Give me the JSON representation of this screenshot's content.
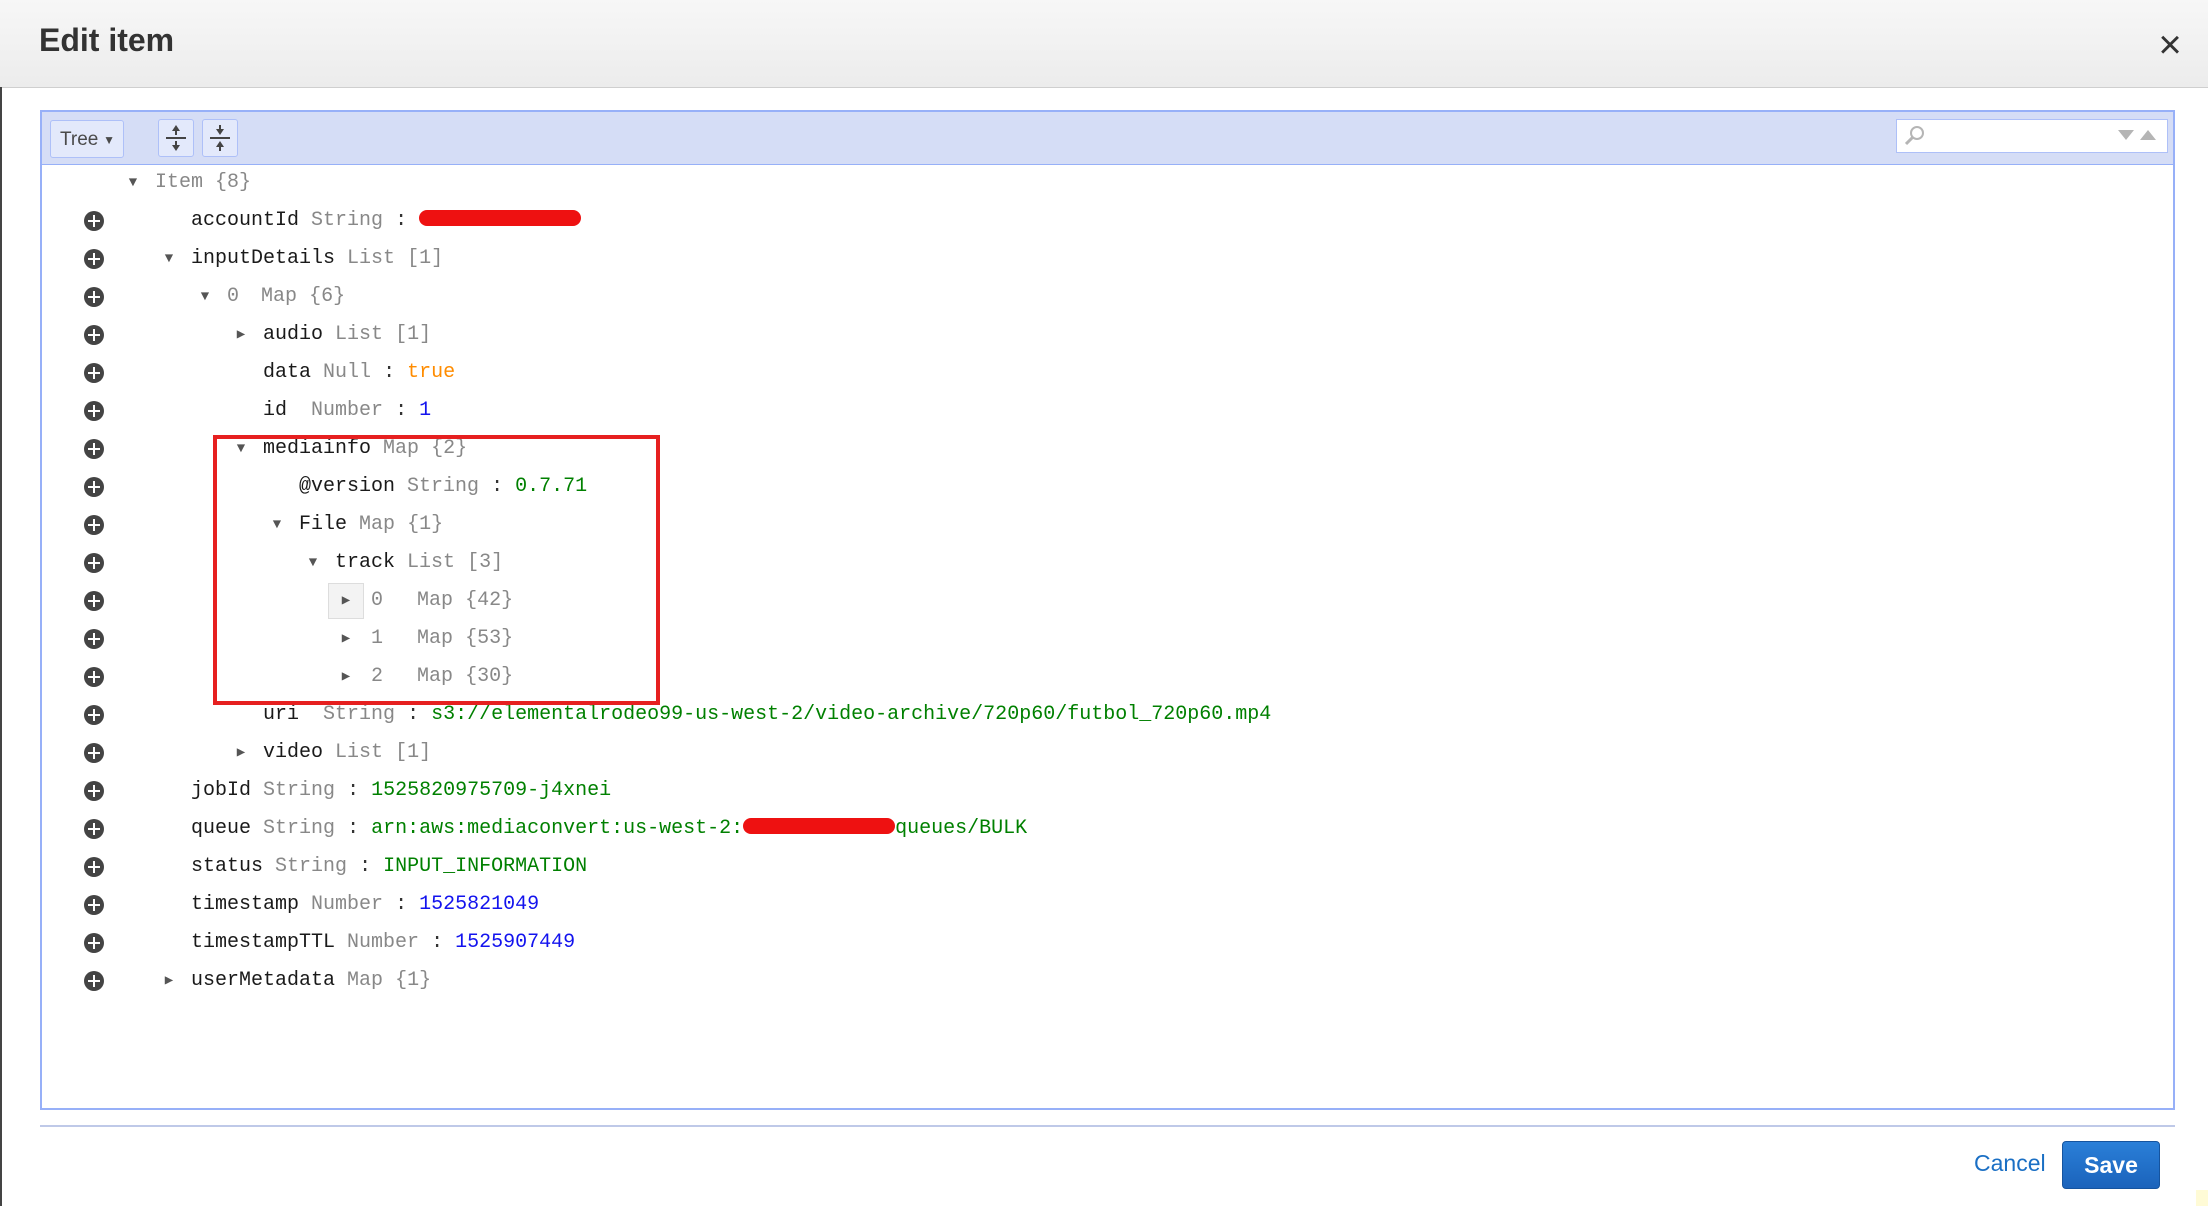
{
  "modal": {
    "title": "Edit item",
    "close_icon": "×"
  },
  "toolbar": {
    "mode_label": "Tree",
    "expand_all_icon": "expand-all-icon",
    "collapse_all_icon": "collapse-all-icon",
    "search_placeholder": ""
  },
  "tree": {
    "root_label": "Item",
    "root_count": "{8}",
    "rows": [
      {
        "key": "accountId",
        "type": "String",
        "value_kind": "redacted"
      },
      {
        "key": "inputDetails",
        "type": "List",
        "count": "[1]"
      },
      {
        "key": "0",
        "type": "Map",
        "count": "{6}"
      },
      {
        "key": "audio",
        "type": "List",
        "count": "[1]"
      },
      {
        "key": "data",
        "type": "Null",
        "value": "true"
      },
      {
        "key": "id",
        "type": "Number",
        "value": "1"
      },
      {
        "key": "mediainfo",
        "type": "Map",
        "count": "{2}"
      },
      {
        "key": "@version",
        "type": "String",
        "value": "0.7.71"
      },
      {
        "key": "File",
        "type": "Map",
        "count": "{1}"
      },
      {
        "key": "track",
        "type": "List",
        "count": "[3]"
      },
      {
        "key": "0",
        "type": "Map",
        "count": "{42}"
      },
      {
        "key": "1",
        "type": "Map",
        "count": "{53}"
      },
      {
        "key": "2",
        "type": "Map",
        "count": "{30}"
      },
      {
        "key": "uri",
        "type": "String",
        "value": "s3://elementalrodeo99-us-west-2/video-archive/720p60/futbol_720p60.mp4"
      },
      {
        "key": "video",
        "type": "List",
        "count": "[1]"
      },
      {
        "key": "jobId",
        "type": "String",
        "value": "1525820975709-j4xnei"
      },
      {
        "key": "queue",
        "type": "String",
        "value_prefix": "arn:aws:mediaconvert:us-west-2:",
        "value_suffix": "queues/BULK"
      },
      {
        "key": "status",
        "type": "String",
        "value": "INPUT_INFORMATION"
      },
      {
        "key": "timestamp",
        "type": "Number",
        "value": "1525821049"
      },
      {
        "key": "timestampTTL",
        "type": "Number",
        "value": "1525907449"
      },
      {
        "key": "userMetadata",
        "type": "Map",
        "count": "{1}"
      }
    ],
    "separator": ":"
  },
  "footer": {
    "cancel_label": "Cancel",
    "save_label": "Save"
  },
  "colors": {
    "string_value": "#008000",
    "number_value": "#1313ee",
    "boolean_value": "#ff8c00",
    "annotation_box": "#e62020",
    "redaction": "#ee1111",
    "save_button": "#1b63bb"
  }
}
